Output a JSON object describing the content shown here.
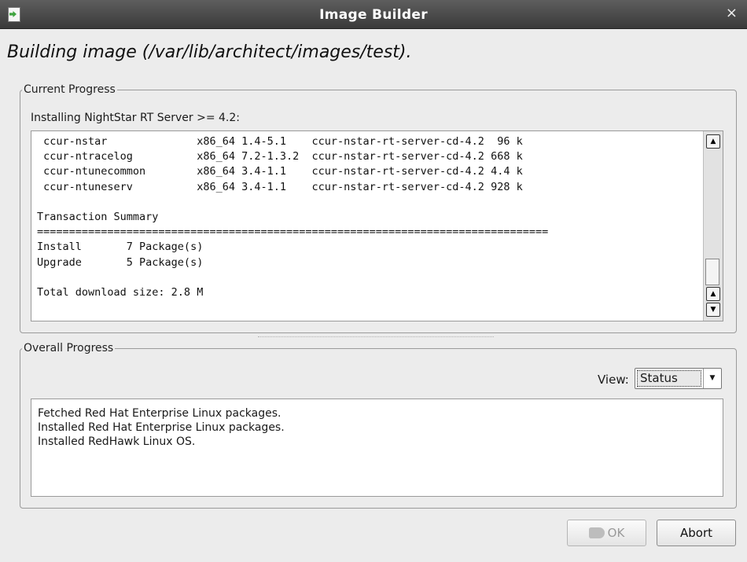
{
  "window": {
    "title": "Image Builder",
    "close_glyph": "×"
  },
  "heading": "Building image (/var/lib/architect/images/test).",
  "current_progress": {
    "legend": "Current Progress",
    "installing_label": "Installing NightStar RT Server >= 4.2:",
    "log_text": " ccur-nstar              x86_64 1.4-5.1    ccur-nstar-rt-server-cd-4.2  96 k\n ccur-ntracelog          x86_64 7.2-1.3.2  ccur-nstar-rt-server-cd-4.2 668 k\n ccur-ntunecommon        x86_64 3.4-1.1    ccur-nstar-rt-server-cd-4.2 4.4 k\n ccur-ntuneserv          x86_64 3.4-1.1    ccur-nstar-rt-server-cd-4.2 928 k\n\nTransaction Summary\n================================================================================\nInstall       7 Package(s)\nUpgrade       5 Package(s)\n\nTotal download size: 2.8 M"
  },
  "overall_progress": {
    "legend": "Overall Progress",
    "view_label": "View:",
    "view_selected": "Status",
    "status_lines": [
      "Fetched Red Hat Enterprise Linux packages.",
      "Installed Red Hat Enterprise Linux packages.",
      "Installed RedHawk Linux OS."
    ]
  },
  "buttons": {
    "ok_label": "OK",
    "abort_label": "Abort"
  },
  "icons": {
    "app": "app-icon",
    "close": "close-icon",
    "scroll_up": "scroll-up-icon",
    "scroll_down": "scroll-down-icon",
    "dropdown": "chevron-down-icon",
    "ok": "ok-hand-icon"
  }
}
